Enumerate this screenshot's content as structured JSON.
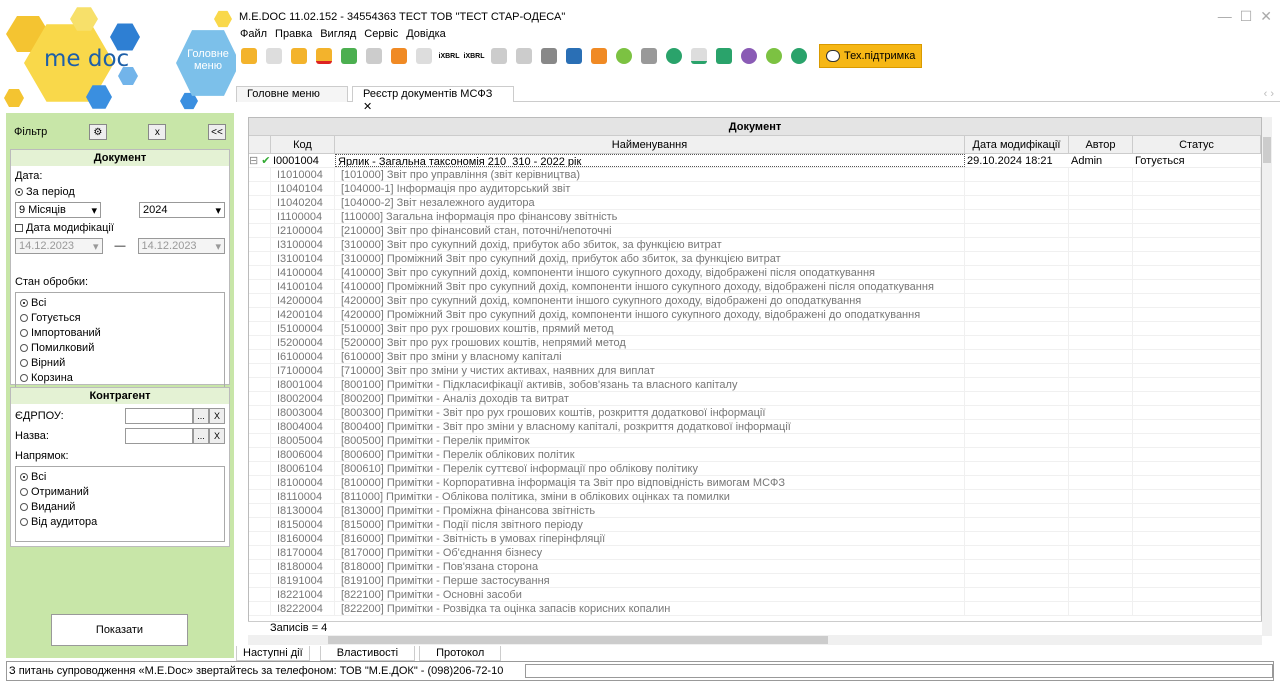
{
  "window": {
    "title": "M.E.DOC 11.02.152  - 34554363 ТЕСТ ТОВ \"ТЕСТ СТАР-ОДЕСА\""
  },
  "logo": {
    "text": "me doc",
    "menu_label": "Головне меню"
  },
  "menu": {
    "items": [
      "Файл",
      "Правка",
      "Вигляд",
      "Сервіс",
      "Довідка"
    ]
  },
  "toolbar": {
    "support_label": "Тех.підтримка",
    "ixbrl1": "iXBRL",
    "ixbrl2": "iXBRL"
  },
  "tabs": [
    {
      "label": "Головне меню"
    },
    {
      "label": "Реєстр документів МСФЗ"
    }
  ],
  "sidebar": {
    "filter_label": "Фільтр",
    "collapse_label": "x",
    "back_label": "<<",
    "document_title": "Документ",
    "date_label": "Дата:",
    "period_label": "За період",
    "period_value": "9 Місяців",
    "year_value": "2024",
    "mod_date_label": "Дата модифікації",
    "date_from": "14.12.2023",
    "date_to": "14.12.2023",
    "state_label": "Стан обробки:",
    "states": [
      "Всі",
      "Готується",
      "Імпортований",
      "Помилковий",
      "Вірний",
      "Корзина"
    ],
    "contractor_title": "Контрагент",
    "edrpou_label": "ЄДРПОУ:",
    "name_label": "Назва:",
    "direction_label": "Напрямок:",
    "directions": [
      "Всі",
      "Отриманий",
      "Виданий",
      "Від аудитора"
    ],
    "show_button": "Показати"
  },
  "grid": {
    "group_header": "Документ",
    "columns": [
      "Код",
      "Найменування",
      "Дата модифікації",
      "Автор",
      "Статус"
    ],
    "main_row": {
      "code": "I0001004",
      "name": "Ярлик - Загальна таксономія 210_310 - 2022 рік",
      "date": "29.10.2024 18:21",
      "author": "Admin",
      "status": "Готується"
    },
    "child_rows": [
      [
        "I1010004",
        "[101000] Звіт про управління (звіт керівництва)"
      ],
      [
        "I1040104",
        "[104000-1] Інформація про аудиторський звіт"
      ],
      [
        "I1040204",
        "[104000-2] Звіт незалежного аудитора"
      ],
      [
        "I1100004",
        "[110000] Загальна інформація про фінансову звітність"
      ],
      [
        "I2100004",
        "[210000] Звіт про фінансовий стан, поточні/непоточні"
      ],
      [
        "I3100004",
        "[310000] Звіт про сукупний дохід, прибуток або збиток, за функцією витрат"
      ],
      [
        "I3100104",
        "[310000] Проміжний Звіт про сукупний дохід, прибуток або збиток, за функцією витрат"
      ],
      [
        "I4100004",
        "[410000] Звіт про сукупний дохід, компоненти іншого сукупного доходу, відображені після оподаткування"
      ],
      [
        "I4100104",
        "[410000] Проміжний Звіт про сукупний дохід, компоненти іншого сукупного доходу, відображені після оподаткування"
      ],
      [
        "I4200004",
        "[420000] Звіт про сукупний дохід, компоненти іншого сукупного доходу, відображені до оподаткування"
      ],
      [
        "I4200104",
        "[420000] Проміжний Звіт про сукупний дохід, компоненти іншого сукупного доходу, відображені до оподаткування"
      ],
      [
        "I5100004",
        "[510000] Звіт про рух грошових коштів, прямий метод"
      ],
      [
        "I5200004",
        "[520000] Звіт про рух грошових коштів, непрямий метод"
      ],
      [
        "I6100004",
        "[610000] Звіт про зміни у власному капіталі"
      ],
      [
        "I7100004",
        "[710000] Звіт про зміни у чистих активах, наявних для виплат"
      ],
      [
        "I8001004",
        "[800100] Примітки - Підкласифікації активів, зобов'язань та власного капіталу"
      ],
      [
        "I8002004",
        "[800200] Примітки - Аналіз доходів та витрат"
      ],
      [
        "I8003004",
        "[800300] Примітки - Звіт про рух грошових коштів, розкриття додаткової інформації"
      ],
      [
        "I8004004",
        "[800400] Примітки - Звіт про зміни у власному капіталі, розкриття додаткової інформації"
      ],
      [
        "I8005004",
        "[800500] Примітки - Перелік приміток"
      ],
      [
        "I8006004",
        "[800600] Примітки - Перелік облікових політик"
      ],
      [
        "I8006104",
        "[800610] Примітки - Перелік суттєвої інформації про облікову політику"
      ],
      [
        "I8100004",
        "[810000] Примітки - Корпоративна інформація та Звіт про відповідність вимогам МСФЗ"
      ],
      [
        "I8110004",
        "[811000] Примітки - Облікова політика, зміни в облікових оцінках та помилки"
      ],
      [
        "I8130004",
        "[813000] Примітки - Проміжна фінансова звітність"
      ],
      [
        "I8150004",
        "[815000] Примітки - Події після звітного періоду"
      ],
      [
        "I8160004",
        "[816000] Примітки - Звітність в умовах гіперінфляції"
      ],
      [
        "I8170004",
        "[817000] Примітки - Об'єднання бізнесу"
      ],
      [
        "I8180004",
        "[818000] Примітки - Пов'язана сторона"
      ],
      [
        "I8191004",
        "[819100] Примітки - Перше застосування"
      ],
      [
        "I8221004",
        "[822100] Примітки - Основні засоби"
      ],
      [
        "I8222004",
        "[822200] Примітки - Розвідка та оцінка запасів корисних копалин"
      ]
    ],
    "records_label": "Записів = 4"
  },
  "bottom_tabs": [
    "Наступні дії",
    "Властивості",
    "Протокол"
  ],
  "status": {
    "text": "З питань супроводження «M.E.Doc» звертайтесь за телефоном: ТОВ \"М.Е.ДОК\" - (098)206-72-10"
  },
  "colors": {
    "sidebar": "#c8e6a8",
    "support": "#f6b716",
    "logo_blue": "#1d5fa8"
  }
}
